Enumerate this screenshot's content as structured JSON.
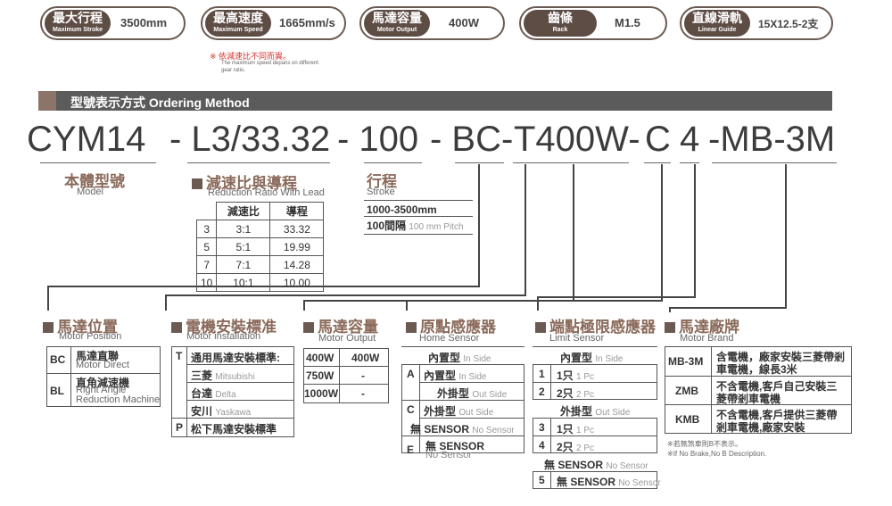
{
  "specs": [
    {
      "zh": "最大行程",
      "en": "Maximum Stroke",
      "value": "3500mm"
    },
    {
      "zh": "最高速度",
      "en": "Maximum Speed",
      "value": "1665mm/s"
    },
    {
      "zh": "馬達容量",
      "en": "Motor Output",
      "value": "400W"
    },
    {
      "zh": "齒條",
      "en": "Rack",
      "value": "M1.5"
    },
    {
      "zh": "直線滑軌",
      "en": "Linear Guide",
      "value": "15X12.5-2支"
    }
  ],
  "speed_note": {
    "zh": "※ 依減速比不同而異。",
    "en": "The maximum speed depans on different gear ratio."
  },
  "section_title": "型號表示方式  Ordering Method",
  "model_code": [
    "CYM14",
    "- L3/33.32",
    "- 100",
    "- BC-",
    "T400W-",
    "C",
    "4",
    "-MB-3M"
  ],
  "model": {
    "zh": "本體型號",
    "en": "Model"
  },
  "reduction": {
    "zh": "減速比與導程",
    "en": "Reduction Ratio With  Lead",
    "headers": [
      "減速比",
      "導程"
    ],
    "rows": [
      [
        "3",
        "3:1",
        "33.32"
      ],
      [
        "5",
        "5:1",
        "19.99"
      ],
      [
        "7",
        "7:1",
        "14.28"
      ],
      [
        "10",
        "10:1",
        "10.00"
      ]
    ]
  },
  "stroke": {
    "zh": "行程",
    "en": "Stroke",
    "range": "1000-3500mm",
    "pitch_zh": "100間隔",
    "pitch_en": "100 mm Pitch"
  },
  "motor_position": {
    "zh": "馬達位置",
    "en": "Motor Position",
    "rows": [
      {
        "code": "BC",
        "zh": "馬達直聯",
        "en": "Motor Direct"
      },
      {
        "code": "BL",
        "zh": "直角減速機",
        "en1": "Right Angle",
        "en2": "Reduction Machine"
      }
    ]
  },
  "motor_install": {
    "zh": "電機安裝標准",
    "en": "Motor installation",
    "rows": [
      {
        "code": "T",
        "zh": "通用馬達安裝標準:"
      },
      {
        "code": "",
        "zh": "三菱",
        "en": "Mitsubishi"
      },
      {
        "code": "",
        "zh": "台達",
        "en": "Delta"
      },
      {
        "code": "",
        "zh": "安川",
        "en": "Yaskawa"
      },
      {
        "code": "P",
        "zh": "松下馬達安裝標準"
      }
    ]
  },
  "motor_output": {
    "zh": "馬達容量",
    "en": "Motor Output",
    "rows": [
      [
        "400W",
        "400W"
      ],
      [
        "750W",
        "-"
      ],
      [
        "1000W",
        "-"
      ]
    ]
  },
  "home_sensor": {
    "zh": "原點感應器",
    "en": "Home Sensor",
    "inside": {
      "zh": "內置型",
      "en": "In Side"
    },
    "a": {
      "code": "A",
      "zh": "內置型",
      "en": "In Side"
    },
    "outside": {
      "zh": "外掛型",
      "en": "Out Side"
    },
    "c": {
      "code": "C",
      "zh": "外掛型",
      "en": "Out Side"
    },
    "none": {
      "zh": "無 SENSOR",
      "en": "No Sensor"
    },
    "e": {
      "code": "E",
      "zh": "無  SENSOR",
      "en": "No Sensor"
    }
  },
  "limit_sensor": {
    "zh": "端點極限感應器",
    "en": "Limit Sensor",
    "inside": {
      "zh": "內置型",
      "en": "In Side"
    },
    "r1": {
      "code": "1",
      "zh": "1只",
      "en": "1 Pc"
    },
    "r2": {
      "code": "2",
      "zh": "2只",
      "en": "2 Pc"
    },
    "outside": {
      "zh": "外掛型",
      "en": "Out Side"
    },
    "r3": {
      "code": "3",
      "zh": "1只",
      "en": "1 Pc"
    },
    "r4": {
      "code": "4",
      "zh": "2只",
      "en": "2 Pc"
    },
    "none": {
      "zh": "無 SENSOR",
      "en": "No Sensor"
    },
    "r5": {
      "code": "5",
      "zh": "無 SENSOR",
      "en": "No Sensor"
    }
  },
  "motor_brand": {
    "zh": "馬達廠牌",
    "en": "Motor Brand",
    "rows": [
      {
        "code": "MB-3M",
        "l1": "含電機，廠家安裝三菱帶剎",
        "l2": "車電機，線長3米"
      },
      {
        "code": "ZMB",
        "l1": "不含電機,客戶自己安裝三",
        "l2": "菱帶剎車電機"
      },
      {
        "code": "KMB",
        "l1": "不含電機,客戶提供三菱帶",
        "l2": "剎車電機,廠家安裝"
      }
    ],
    "note_zh": "※若無煞車則B不表示。",
    "note_en": "※If No Brake,No B Description."
  }
}
